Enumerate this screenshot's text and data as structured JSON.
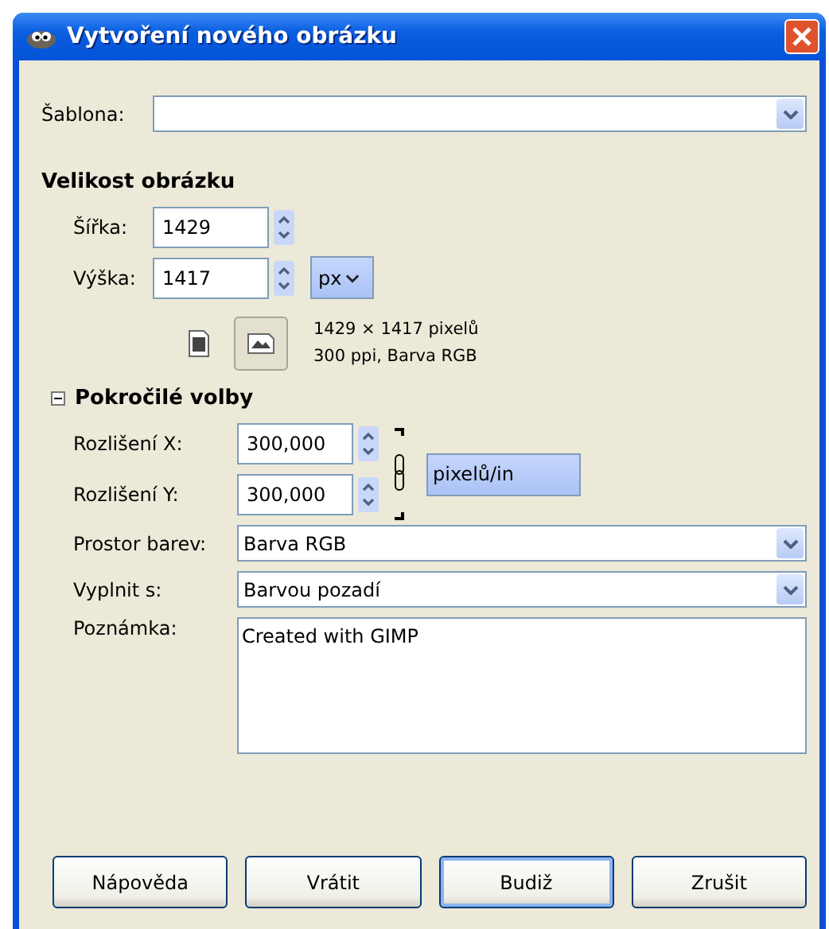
{
  "window": {
    "title": "Vytvoření nového obrázku"
  },
  "template": {
    "label": "Šablona:"
  },
  "size_section": {
    "title": "Velikost obrázku",
    "width": {
      "label": "Šířka:",
      "value": "1429"
    },
    "height": {
      "label": "Výška:",
      "value": "1417"
    },
    "unit": "px",
    "orientations": [
      {
        "kind": "portrait",
        "selected": false
      },
      {
        "kind": "landscape",
        "selected": true
      }
    ],
    "info": [
      "1429 × 1417 pixelů",
      "300 ppi, Barva RGB"
    ]
  },
  "advanced": {
    "title": "Pokročilé volby",
    "expanded": true,
    "res_x": {
      "label": "Rozlišení X:",
      "value": "300,000"
    },
    "res_y": {
      "label": "Rozlišení Y:",
      "value": "300,000"
    },
    "chained": true,
    "res_unit": "pixelů/in",
    "color_space": {
      "label": "Prostor barev:",
      "value": "Barva RGB"
    },
    "fill": {
      "label": "Vyplnit s:",
      "value": "Barvou pozadí"
    },
    "comment": {
      "label": "Poznámka:",
      "value": "Created with GIMP"
    }
  },
  "buttons": [
    {
      "label": "Nápověda",
      "default": false
    },
    {
      "label": "Vrátit",
      "default": false
    },
    {
      "label": "Budiž",
      "default": true
    },
    {
      "label": "Zrušit",
      "default": false
    }
  ]
}
